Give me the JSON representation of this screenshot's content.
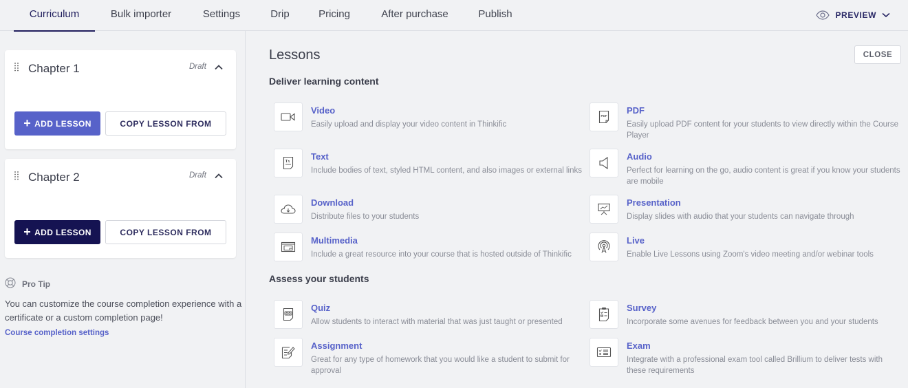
{
  "nav": {
    "tabs": [
      {
        "label": "Curriculum",
        "active": true
      },
      {
        "label": "Bulk importer",
        "active": false
      },
      {
        "label": "Settings",
        "active": false
      },
      {
        "label": "Drip",
        "active": false
      },
      {
        "label": "Pricing",
        "active": false
      },
      {
        "label": "After purchase",
        "active": false
      },
      {
        "label": "Publish",
        "active": false
      }
    ],
    "preview_label": "PREVIEW"
  },
  "sidebar": {
    "chapters": [
      {
        "title": "Chapter 1",
        "status": "Draft",
        "add_lesson_label": "ADD LESSON",
        "copy_lesson_label": "COPY LESSON FROM"
      },
      {
        "title": "Chapter 2",
        "status": "Draft",
        "add_lesson_label": "ADD LESSON",
        "copy_lesson_label": "COPY LESSON FROM"
      }
    ],
    "pro_tip": {
      "heading": "Pro Tip",
      "text": "You can customize the course completion experience with a certificate or a custom completion page!",
      "link": "Course completion settings"
    }
  },
  "lessons_panel": {
    "title": "Lessons",
    "close_label": "CLOSE",
    "sections": [
      {
        "title": "Deliver learning content",
        "items": [
          {
            "name": "Video",
            "icon": "video-camera-icon",
            "description": "Easily upload and display your video content in Thinkific"
          },
          {
            "name": "PDF",
            "icon": "pdf-file-icon",
            "description": "Easily upload PDF content for your students to view directly within the Course Player"
          },
          {
            "name": "Text",
            "icon": "text-document-icon",
            "description": "Include bodies of text, styled HTML content, and also images or external links"
          },
          {
            "name": "Audio",
            "icon": "speaker-icon",
            "description": "Perfect for learning on the go, audio content is great if you know your students are mobile"
          },
          {
            "name": "Download",
            "icon": "cloud-download-icon",
            "description": "Distribute files to your students"
          },
          {
            "name": "Presentation",
            "icon": "presentation-board-icon",
            "description": "Display slides with audio that your students can navigate through"
          },
          {
            "name": "Multimedia",
            "icon": "multimedia-window-icon",
            "description": "Include a great resource into your course that is hosted outside of Thinkific"
          },
          {
            "name": "Live",
            "icon": "broadcast-icon",
            "description": "Enable Live Lessons using Zoom's video meeting and/or webinar tools"
          }
        ]
      },
      {
        "title": "Assess your students",
        "items": [
          {
            "name": "Quiz",
            "icon": "quiz-document-icon",
            "description": "Allow students to interact with material that was just taught or presented"
          },
          {
            "name": "Survey",
            "icon": "clipboard-checklist-icon",
            "description": "Incorporate some avenues for feedback between you and your students"
          },
          {
            "name": "Assignment",
            "icon": "edit-document-icon",
            "description": "Great for any type of homework that you would like a student to submit for approval"
          },
          {
            "name": "Exam",
            "icon": "exam-checklist-icon",
            "description": "Integrate with a professional exam tool called Brillium to deliver tests with these requirements"
          }
        ]
      }
    ]
  }
}
